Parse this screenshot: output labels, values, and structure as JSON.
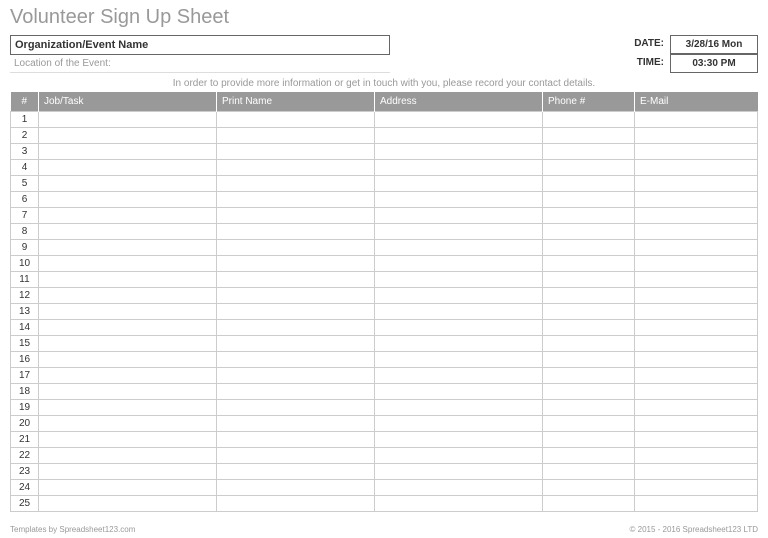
{
  "title": "Volunteer Sign Up Sheet",
  "org_label": "Organization/Event Name",
  "location_label": "Location of the Event:",
  "date_label": "DATE:",
  "date_value": "3/28/16 Mon",
  "time_label": "TIME:",
  "time_value": "03:30 PM",
  "instruction": "In order to provide more information or get in touch with you, please record your contact details.",
  "columns": {
    "num": "#",
    "job": "Job/Task",
    "name": "Print Name",
    "address": "Address",
    "phone": "Phone #",
    "email": "E-Mail"
  },
  "rows": [
    1,
    2,
    3,
    4,
    5,
    6,
    7,
    8,
    9,
    10,
    11,
    12,
    13,
    14,
    15,
    16,
    17,
    18,
    19,
    20,
    21,
    22,
    23,
    24,
    25
  ],
  "footer_left": "Templates by Spreadsheet123.com",
  "footer_right": "© 2015 - 2016 Spreadsheet123 LTD"
}
